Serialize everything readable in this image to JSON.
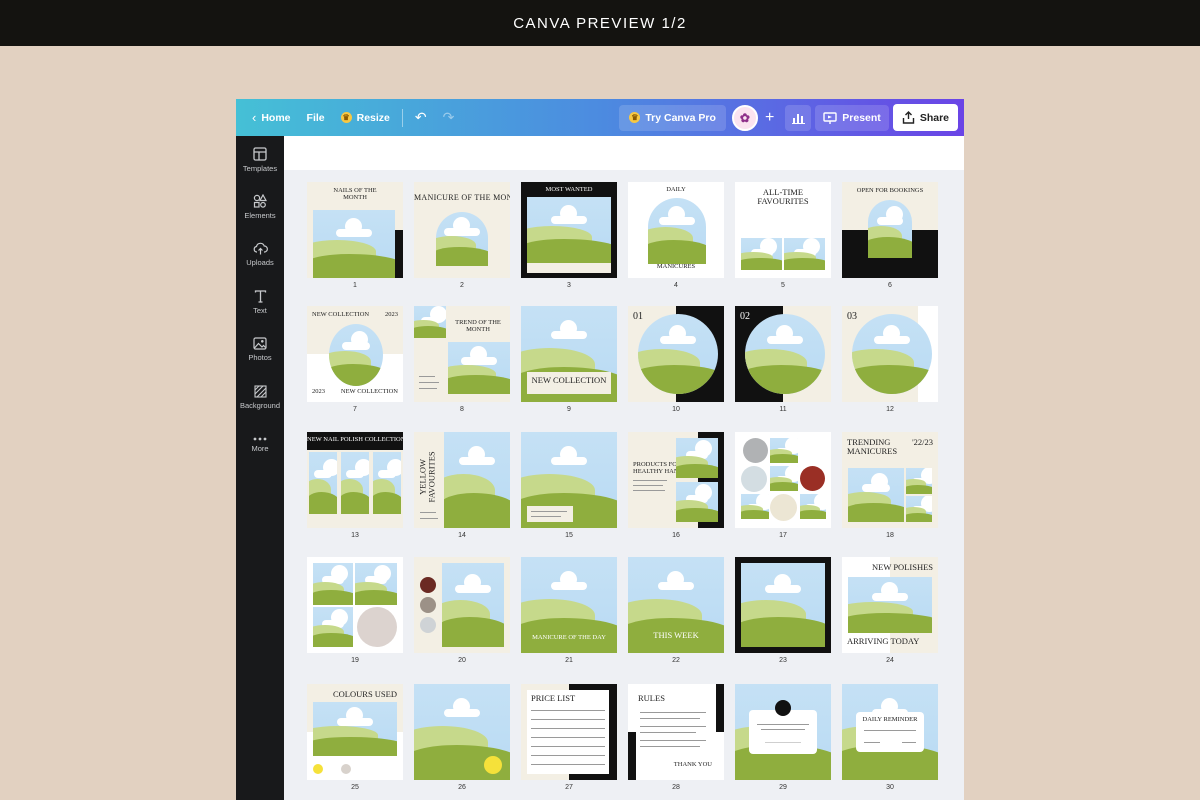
{
  "banner": {
    "title": "CANVA PREVIEW 1/2"
  },
  "header": {
    "home_label": "Home",
    "file_label": "File",
    "resize_label": "Resize",
    "try_pro_label": "Try Canva Pro",
    "present_label": "Present",
    "share_label": "Share"
  },
  "sidebar": {
    "items": [
      {
        "label": "Templates",
        "icon": "templates-icon"
      },
      {
        "label": "Elements",
        "icon": "elements-icon"
      },
      {
        "label": "Uploads",
        "icon": "uploads-icon"
      },
      {
        "label": "Text",
        "icon": "text-icon"
      },
      {
        "label": "Photos",
        "icon": "photos-icon"
      },
      {
        "label": "Background",
        "icon": "background-icon"
      },
      {
        "label": "More",
        "icon": "more-icon"
      }
    ]
  },
  "pages": {
    "numbers": [
      "1",
      "2",
      "3",
      "4",
      "5",
      "6",
      "7",
      "8",
      "9",
      "10",
      "11",
      "12",
      "13",
      "14",
      "15",
      "16",
      "17",
      "18",
      "19",
      "20",
      "21",
      "22",
      "23",
      "24",
      "25",
      "26",
      "27",
      "28",
      "29",
      "30"
    ],
    "texts": {
      "t1": "NAILS OF THE\nMONTH",
      "t2": "MANICURE OF THE MONTH",
      "t3": "MOST WANTED",
      "t4a": "DAILY",
      "t4b": "MANICURES",
      "t5": "ALL-TIME\nFAVOURITES",
      "t6": "OPEN FOR BOOKINGS",
      "t7a": "NEW COLLECTION",
      "t7b": "2023",
      "t7c": "2023",
      "t7d": "NEW COLLECTION",
      "t8": "TREND OF THE\nMONTH",
      "t9": "NEW COLLECTION",
      "t10": "01",
      "t11": "02",
      "t12": "03",
      "t13": "NEW NAIL POLISH COLLECTION",
      "t14": "YELLOW\nFAVOURITES",
      "t16": "PRODUCTS FOR\nHEALTHY HANDS",
      "t18a": "TRENDING\nMANICURES",
      "t18b": "'22/23",
      "t21": "MANICURE OF THE DAY",
      "t22": "THIS WEEK",
      "t24a": "NEW POLISHES",
      "t24b": "ARRIVING TODAY",
      "t25": "COLOURS USED",
      "t27": "PRICE LIST",
      "t28a": "RULES",
      "t28b": "THANK YOU",
      "t30": "DAILY REMINDER"
    }
  },
  "colors": {
    "cream": "#f3efe4",
    "black": "#111111",
    "sky": "#c5e1f5",
    "grass_dark": "#8fae3e",
    "grass_light": "#c6d98b",
    "swatch_maroon": "#6b2a23",
    "swatch_taupe": "#9c9187",
    "swatch_grey": "#cfd3d6",
    "swatch_red": "#9a2f25",
    "swatch_yellow": "#f5e13a"
  }
}
